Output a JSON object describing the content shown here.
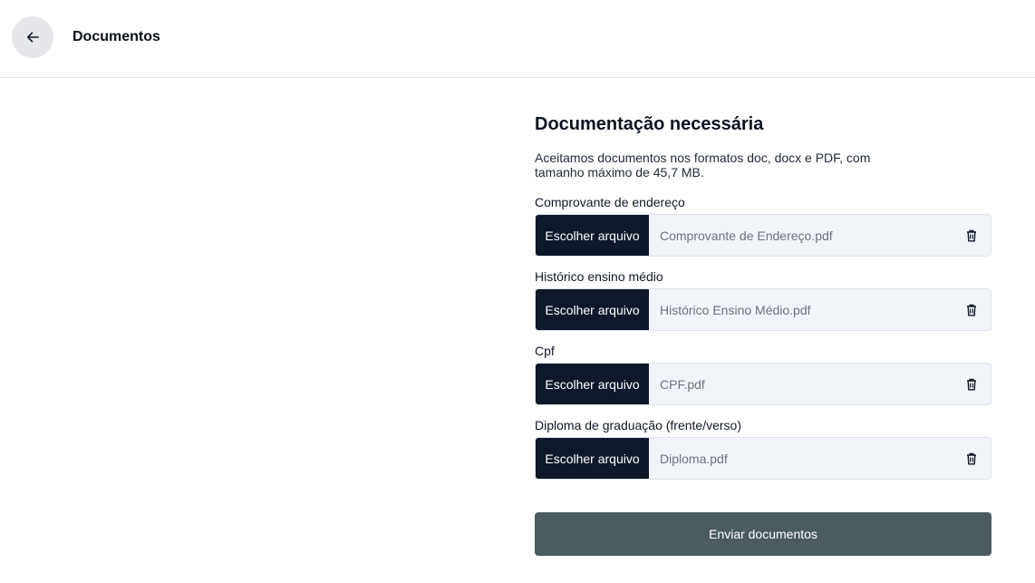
{
  "header": {
    "title": "Documentos",
    "back_icon": "arrow-left-icon"
  },
  "main": {
    "title": "Documentação necessária",
    "description": "Aceitamos documentos nos formatos doc, docx e PDF, com tamanho máximo de 45,7 MB.",
    "documents": [
      {
        "label": "Comprovante de endereço",
        "button": "Escolher arquivo",
        "file_name": "Comprovante de Endereço.pdf",
        "icon": "trash-icon"
      },
      {
        "label": "Histórico ensino médio",
        "button": "Escolher arquivo",
        "file_name": "Histórico Ensino Médio.pdf",
        "icon": "trash-icon"
      },
      {
        "label": "Cpf",
        "button": "Escolher arquivo",
        "file_name": "CPF.pdf",
        "icon": "trash-icon"
      },
      {
        "label": "Diploma de graduação (frente/verso)",
        "button": "Escolher arquivo",
        "file_name": "Diploma.pdf",
        "icon": "trash-icon"
      }
    ],
    "submit_label": "Enviar documentos"
  },
  "colors": {
    "dark_button": "#0f172a",
    "submit_button": "#4b5b5f",
    "file_field_bg": "#f1f4f9"
  }
}
